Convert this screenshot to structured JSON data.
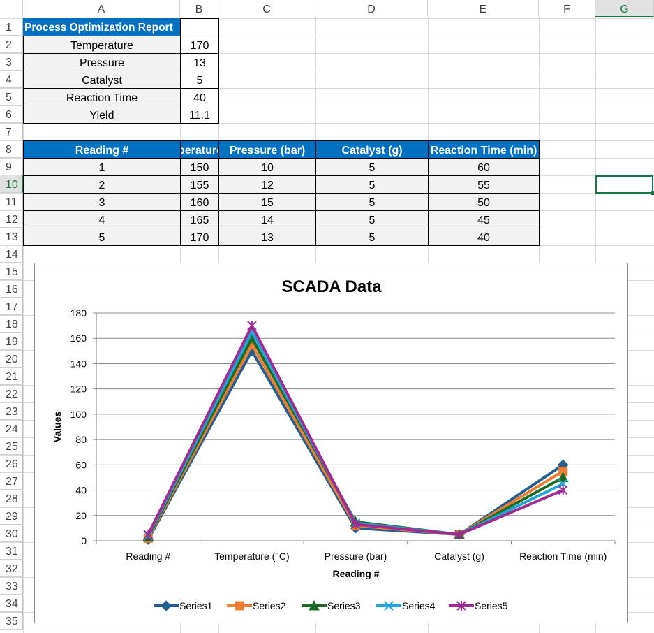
{
  "columns": [
    "A",
    "B",
    "C",
    "D",
    "E",
    "F",
    "G"
  ],
  "rows": [
    "1",
    "2",
    "3",
    "4",
    "5",
    "6",
    "7",
    "8",
    "9",
    "10",
    "11",
    "12",
    "13",
    "14",
    "15",
    "16",
    "17",
    "18",
    "19",
    "20",
    "21",
    "22",
    "23",
    "24",
    "25",
    "26",
    "27",
    "28",
    "29",
    "30",
    "31",
    "32",
    "33",
    "34",
    "35"
  ],
  "report": {
    "title": "Process Optimization Report",
    "items": [
      {
        "label": "Temperature",
        "value": "170"
      },
      {
        "label": "Pressure",
        "value": "13"
      },
      {
        "label": "Catalyst",
        "value": "5"
      },
      {
        "label": "Reaction Time",
        "value": "40"
      },
      {
        "label": "Yield",
        "value": "11.1"
      }
    ]
  },
  "table": {
    "headers": [
      "Reading #",
      "Temperature (°C)",
      "Pressure (bar)",
      "Catalyst (g)",
      "Reaction Time (min)"
    ],
    "headers_visible": [
      "Reading #",
      "perature",
      "Pressure (bar)",
      "Catalyst (g)",
      "Reaction Time (min)"
    ],
    "rows": [
      [
        "1",
        "150",
        "10",
        "5",
        "60"
      ],
      [
        "2",
        "155",
        "12",
        "5",
        "55"
      ],
      [
        "3",
        "160",
        "15",
        "5",
        "50"
      ],
      [
        "4",
        "165",
        "14",
        "5",
        "45"
      ],
      [
        "5",
        "170",
        "13",
        "5",
        "40"
      ]
    ]
  },
  "selected_cell": "G10",
  "colors": {
    "header_blue": "#0070c0",
    "excel_green": "#107c41"
  },
  "chart_data": {
    "type": "line",
    "title": "SCADA Data",
    "xlabel": "Reading #",
    "ylabel": "Values",
    "categories": [
      "Reading #",
      "Temperature (°C)",
      "Pressure (bar)",
      "Catalyst (g)",
      "Reaction Time (min)"
    ],
    "ylim": [
      0,
      180
    ],
    "yticks": [
      "0",
      "20",
      "40",
      "60",
      "80",
      "100",
      "120",
      "140",
      "160",
      "180"
    ],
    "grid": true,
    "legend_position": "bottom",
    "series": [
      {
        "name": "Series1",
        "color": "#255e91",
        "marker": "diamond",
        "values": [
          1,
          150,
          10,
          5,
          60
        ]
      },
      {
        "name": "Series2",
        "color": "#ed7d31",
        "marker": "square",
        "values": [
          2,
          155,
          12,
          5,
          55
        ]
      },
      {
        "name": "Series3",
        "color": "#1e6b24",
        "marker": "triangle",
        "values": [
          3,
          160,
          15,
          5,
          50
        ]
      },
      {
        "name": "Series4",
        "color": "#1ea7d6",
        "marker": "x",
        "values": [
          4,
          165,
          14,
          5,
          45
        ]
      },
      {
        "name": "Series5",
        "color": "#a02b93",
        "marker": "star",
        "values": [
          5,
          170,
          13,
          5,
          40
        ]
      }
    ]
  }
}
